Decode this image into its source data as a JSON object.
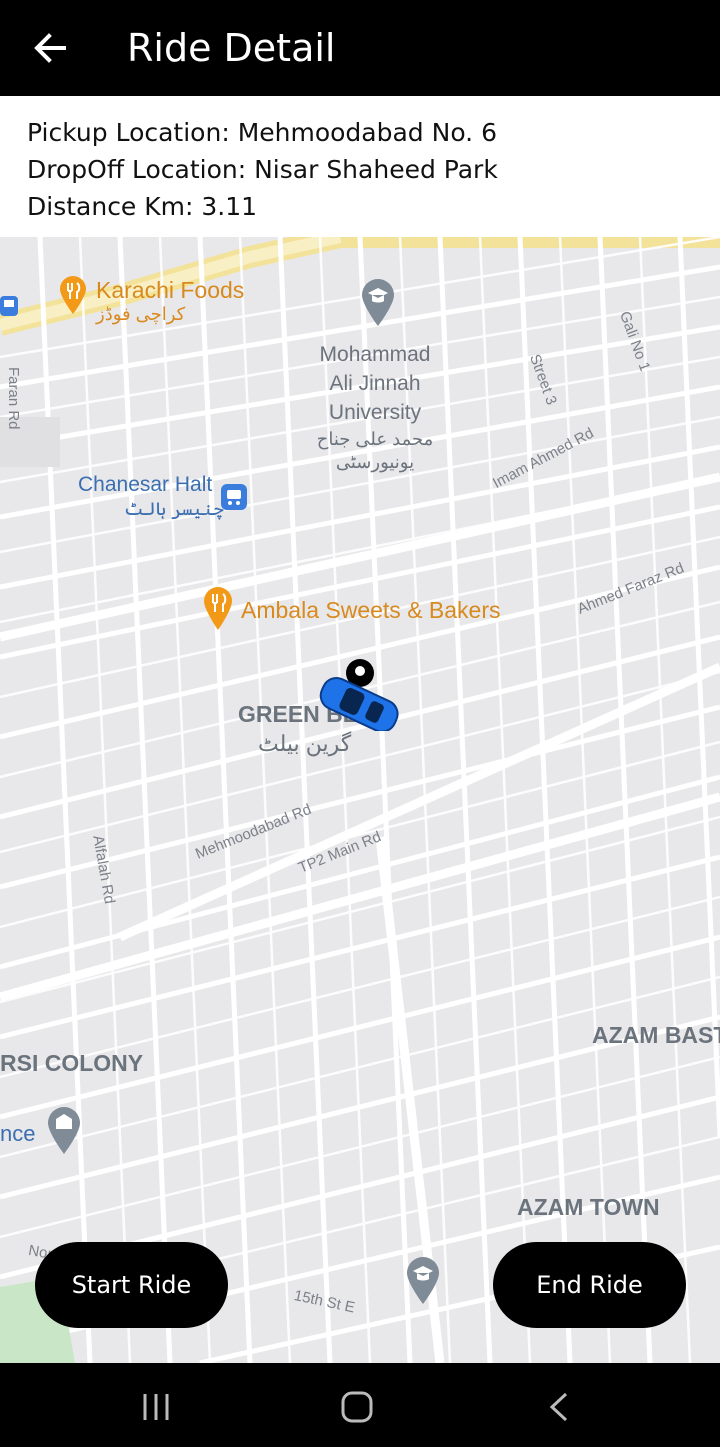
{
  "header": {
    "title": "Ride Detail",
    "back_icon": "arrow-left-icon"
  },
  "ride": {
    "pickup": "Pickup Location: Mehmoodabad No. 6",
    "dropoff": "DropOff Location: Nisar Shaheed Park",
    "distance": "Distance Km: 3.11"
  },
  "map": {
    "pois": {
      "karachi_foods": "Karachi Foods",
      "karachi_foods_urdu": "کراچی فوڈز",
      "university_1": "Mohammad",
      "university_2": "Ali Jinnah",
      "university_3": "University",
      "university_urdu_1": "محمد علی جناح",
      "university_urdu_2": "یونیورسٹی",
      "chanesar": "Chanesar Halt",
      "chanesar_urdu": "چنیسر ہالٹ",
      "ambala": "Ambala Sweets & Bakers",
      "green_belt": "GREEN BE",
      "green_belt_urdu": "گرین بیلٹ",
      "azam_basti": "AZAM BAST",
      "azam_town": "AZAM TOWN",
      "parsi_colony": "RSI COLONY",
      "nce": "nce"
    },
    "roads": {
      "faran": "Faran Rd",
      "gali": "Gali No 1",
      "street3": "Street 3",
      "imam": "Imam Ahmed Rd",
      "faraz": "Ahmed Faraz Rd",
      "mehmoodabad": "Mehmoodabad Rd",
      "tp2": "TP2 Main Rd",
      "alfalah": "Alfalah Rd",
      "st15": "15th St E",
      "north": "North Ave"
    }
  },
  "actions": {
    "start": "Start Ride",
    "end": "End Ride"
  },
  "system_nav": {
    "recents": "recents-icon",
    "home": "home-icon",
    "back": "back-icon"
  }
}
